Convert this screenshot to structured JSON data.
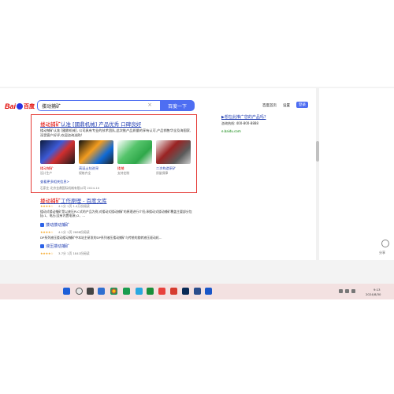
{
  "header": {
    "logo_left": "Bai",
    "logo_right": "百度",
    "query": "搂动捕矿",
    "search_button": "百度一下",
    "links": [
      "百度首页",
      "设置"
    ],
    "login": "登录"
  },
  "ad": {
    "title_pre": "搂动捕矿",
    "title_rest": "认准 [國鼎机械] 产品优秀 口碑良好",
    "desc": "搂动捕矿认准 [國鼎机械], 公司具有专业的技术团队,此次推产品质量的享有认可,产品销售华全及海国家,深受客户好评,欢迎咨询选购!",
    "thumbs": [
      {
        "label": "搂动捕矿",
        "sub": "设计生产"
      },
      {
        "label": "高延土钻进采",
        "sub": "规格齐全"
      },
      {
        "label": "搂捕",
        "sub": "支持定制"
      },
      {
        "label": "二次构造采矿",
        "sub": "质量保障"
      }
    ],
    "more": "查看更多相关信息>",
    "meta": "石家庄 北京金鼎国际机械有限公司 2024-10"
  },
  "results": [
    {
      "title_pre": "搂动捕矿",
      "title_rest": "工作原理 - 百度文库",
      "stars": "★★★★☆",
      "meta": "4.1分  1页  1.4万份阅读",
      "snippet": "搂动式搂动捕矿是以液压PLC式的产品为例,对搂动式搂动捕矿的原理进行介绍;承搂动式搂动捕矿覆盖主要部分包括:1、电压(没有内置电源);2、...",
      "sub": "搂动搂动捕矿"
    },
    {
      "stars": "★★★★☆",
      "meta": "4.1分  1页  2668份阅读",
      "snippet": "DP系列液压搂动搂动捕矿中本站主研发的DP系列液压搂动捕矿与传统的旋转液压驱动机...",
      "sub": "液压搂动捕矿"
    },
    {
      "stars": "★★★★☆",
      "meta": "3.7分  1页  1841份阅读"
    }
  ],
  "right_ad": {
    "title": "想在此推广您的产品吗?",
    "phone": "咨询热线: 400-800-8888",
    "url": "e.baidu.com"
  },
  "sidepanel": {
    "share": "分享"
  },
  "taskbar": {
    "time": "9:13",
    "date": "2024/8/30"
  },
  "colors": {
    "accent": "#4e6ef2",
    "link": "#2440b3",
    "highlight": "#e53935",
    "keyword": "#e10602"
  }
}
